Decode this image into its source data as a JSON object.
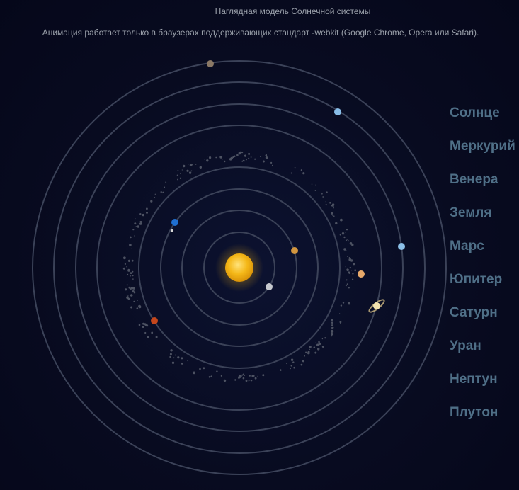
{
  "page": {
    "title": "Наглядная модель Солнечной системы",
    "subtitle": "Анимация работает только в браузерах поддерживающих стандарт -webkit (Google Chrome, Opera или Safari)."
  },
  "menu": {
    "items": [
      {
        "label": "Солнце"
      },
      {
        "label": "Меркурий"
      },
      {
        "label": "Венера"
      },
      {
        "label": "Земля"
      },
      {
        "label": "Марс"
      },
      {
        "label": "Юпитер"
      },
      {
        "label": "Сатурн"
      },
      {
        "label": "Уран"
      },
      {
        "label": "Нептун"
      },
      {
        "label": "Плутон"
      }
    ]
  },
  "colors": {
    "background": "#070a1c",
    "orbit": "#3b4258",
    "menu_text": "#4f6f87",
    "title_text": "#9aa0aa",
    "sun": "#f2b413"
  }
}
